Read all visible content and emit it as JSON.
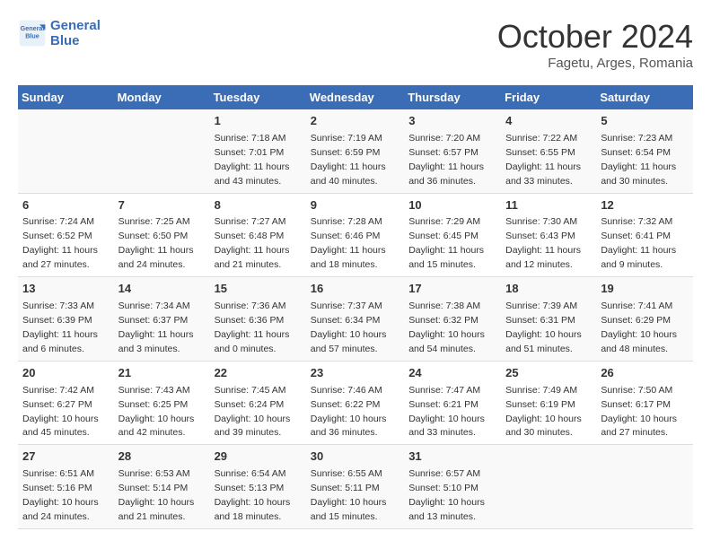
{
  "header": {
    "logo_line1": "General",
    "logo_line2": "Blue",
    "month": "October 2024",
    "location": "Fagetu, Arges, Romania"
  },
  "weekdays": [
    "Sunday",
    "Monday",
    "Tuesday",
    "Wednesday",
    "Thursday",
    "Friday",
    "Saturday"
  ],
  "rows": [
    [
      {
        "day": "",
        "sunrise": "",
        "sunset": "",
        "daylight": ""
      },
      {
        "day": "",
        "sunrise": "",
        "sunset": "",
        "daylight": ""
      },
      {
        "day": "1",
        "sunrise": "Sunrise: 7:18 AM",
        "sunset": "Sunset: 7:01 PM",
        "daylight": "Daylight: 11 hours and 43 minutes."
      },
      {
        "day": "2",
        "sunrise": "Sunrise: 7:19 AM",
        "sunset": "Sunset: 6:59 PM",
        "daylight": "Daylight: 11 hours and 40 minutes."
      },
      {
        "day": "3",
        "sunrise": "Sunrise: 7:20 AM",
        "sunset": "Sunset: 6:57 PM",
        "daylight": "Daylight: 11 hours and 36 minutes."
      },
      {
        "day": "4",
        "sunrise": "Sunrise: 7:22 AM",
        "sunset": "Sunset: 6:55 PM",
        "daylight": "Daylight: 11 hours and 33 minutes."
      },
      {
        "day": "5",
        "sunrise": "Sunrise: 7:23 AM",
        "sunset": "Sunset: 6:54 PM",
        "daylight": "Daylight: 11 hours and 30 minutes."
      }
    ],
    [
      {
        "day": "6",
        "sunrise": "Sunrise: 7:24 AM",
        "sunset": "Sunset: 6:52 PM",
        "daylight": "Daylight: 11 hours and 27 minutes."
      },
      {
        "day": "7",
        "sunrise": "Sunrise: 7:25 AM",
        "sunset": "Sunset: 6:50 PM",
        "daylight": "Daylight: 11 hours and 24 minutes."
      },
      {
        "day": "8",
        "sunrise": "Sunrise: 7:27 AM",
        "sunset": "Sunset: 6:48 PM",
        "daylight": "Daylight: 11 hours and 21 minutes."
      },
      {
        "day": "9",
        "sunrise": "Sunrise: 7:28 AM",
        "sunset": "Sunset: 6:46 PM",
        "daylight": "Daylight: 11 hours and 18 minutes."
      },
      {
        "day": "10",
        "sunrise": "Sunrise: 7:29 AM",
        "sunset": "Sunset: 6:45 PM",
        "daylight": "Daylight: 11 hours and 15 minutes."
      },
      {
        "day": "11",
        "sunrise": "Sunrise: 7:30 AM",
        "sunset": "Sunset: 6:43 PM",
        "daylight": "Daylight: 11 hours and 12 minutes."
      },
      {
        "day": "12",
        "sunrise": "Sunrise: 7:32 AM",
        "sunset": "Sunset: 6:41 PM",
        "daylight": "Daylight: 11 hours and 9 minutes."
      }
    ],
    [
      {
        "day": "13",
        "sunrise": "Sunrise: 7:33 AM",
        "sunset": "Sunset: 6:39 PM",
        "daylight": "Daylight: 11 hours and 6 minutes."
      },
      {
        "day": "14",
        "sunrise": "Sunrise: 7:34 AM",
        "sunset": "Sunset: 6:37 PM",
        "daylight": "Daylight: 11 hours and 3 minutes."
      },
      {
        "day": "15",
        "sunrise": "Sunrise: 7:36 AM",
        "sunset": "Sunset: 6:36 PM",
        "daylight": "Daylight: 11 hours and 0 minutes."
      },
      {
        "day": "16",
        "sunrise": "Sunrise: 7:37 AM",
        "sunset": "Sunset: 6:34 PM",
        "daylight": "Daylight: 10 hours and 57 minutes."
      },
      {
        "day": "17",
        "sunrise": "Sunrise: 7:38 AM",
        "sunset": "Sunset: 6:32 PM",
        "daylight": "Daylight: 10 hours and 54 minutes."
      },
      {
        "day": "18",
        "sunrise": "Sunrise: 7:39 AM",
        "sunset": "Sunset: 6:31 PM",
        "daylight": "Daylight: 10 hours and 51 minutes."
      },
      {
        "day": "19",
        "sunrise": "Sunrise: 7:41 AM",
        "sunset": "Sunset: 6:29 PM",
        "daylight": "Daylight: 10 hours and 48 minutes."
      }
    ],
    [
      {
        "day": "20",
        "sunrise": "Sunrise: 7:42 AM",
        "sunset": "Sunset: 6:27 PM",
        "daylight": "Daylight: 10 hours and 45 minutes."
      },
      {
        "day": "21",
        "sunrise": "Sunrise: 7:43 AM",
        "sunset": "Sunset: 6:25 PM",
        "daylight": "Daylight: 10 hours and 42 minutes."
      },
      {
        "day": "22",
        "sunrise": "Sunrise: 7:45 AM",
        "sunset": "Sunset: 6:24 PM",
        "daylight": "Daylight: 10 hours and 39 minutes."
      },
      {
        "day": "23",
        "sunrise": "Sunrise: 7:46 AM",
        "sunset": "Sunset: 6:22 PM",
        "daylight": "Daylight: 10 hours and 36 minutes."
      },
      {
        "day": "24",
        "sunrise": "Sunrise: 7:47 AM",
        "sunset": "Sunset: 6:21 PM",
        "daylight": "Daylight: 10 hours and 33 minutes."
      },
      {
        "day": "25",
        "sunrise": "Sunrise: 7:49 AM",
        "sunset": "Sunset: 6:19 PM",
        "daylight": "Daylight: 10 hours and 30 minutes."
      },
      {
        "day": "26",
        "sunrise": "Sunrise: 7:50 AM",
        "sunset": "Sunset: 6:17 PM",
        "daylight": "Daylight: 10 hours and 27 minutes."
      }
    ],
    [
      {
        "day": "27",
        "sunrise": "Sunrise: 6:51 AM",
        "sunset": "Sunset: 5:16 PM",
        "daylight": "Daylight: 10 hours and 24 minutes."
      },
      {
        "day": "28",
        "sunrise": "Sunrise: 6:53 AM",
        "sunset": "Sunset: 5:14 PM",
        "daylight": "Daylight: 10 hours and 21 minutes."
      },
      {
        "day": "29",
        "sunrise": "Sunrise: 6:54 AM",
        "sunset": "Sunset: 5:13 PM",
        "daylight": "Daylight: 10 hours and 18 minutes."
      },
      {
        "day": "30",
        "sunrise": "Sunrise: 6:55 AM",
        "sunset": "Sunset: 5:11 PM",
        "daylight": "Daylight: 10 hours and 15 minutes."
      },
      {
        "day": "31",
        "sunrise": "Sunrise: 6:57 AM",
        "sunset": "Sunset: 5:10 PM",
        "daylight": "Daylight: 10 hours and 13 minutes."
      },
      {
        "day": "",
        "sunrise": "",
        "sunset": "",
        "daylight": ""
      },
      {
        "day": "",
        "sunrise": "",
        "sunset": "",
        "daylight": ""
      }
    ]
  ]
}
